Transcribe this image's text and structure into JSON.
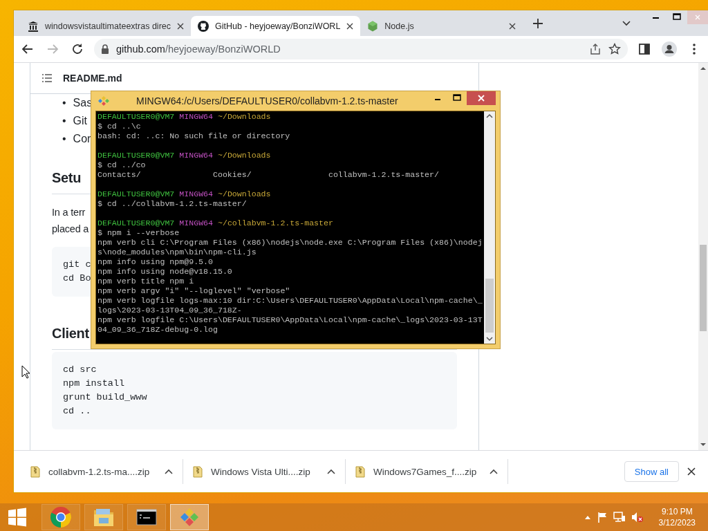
{
  "browser": {
    "tabs": [
      {
        "title": "windowsvistaultimateextras direc",
        "selected": false
      },
      {
        "title": "GitHub - heyjoeway/BonziWORL",
        "selected": true
      },
      {
        "title": "Node.js",
        "selected": false
      }
    ],
    "forward_disabled": true,
    "url": {
      "host": "github.com",
      "path": "/heyjoeway/BonziWORLD"
    }
  },
  "readme": {
    "file": "README.md",
    "blocks": [
      {
        "kind": "list",
        "marker": "•",
        "items": [
          "Sas",
          "Git",
          "Cor"
        ]
      },
      {
        "kind": "heading",
        "text": "Setu"
      },
      {
        "kind": "paragraph",
        "lines": [
          "In a terr",
          "placed a"
        ]
      },
      {
        "kind": "code",
        "lines": [
          "git c",
          "cd Bo"
        ]
      },
      {
        "kind": "heading",
        "text": "Client"
      },
      {
        "kind": "code",
        "lines": [
          "cd src",
          "npm install",
          "grunt build_www",
          "cd .."
        ]
      }
    ]
  },
  "downloads": {
    "items": [
      {
        "name": "collabvm-1.2.ts-ma....zip"
      },
      {
        "name": "Windows Vista Ulti....zip"
      },
      {
        "name": "Windows7Games_f....zip"
      }
    ],
    "button": "Show all"
  },
  "terminal": {
    "title": "MINGW64:/c/Users/DEFAULTUSER0/collabvm-1.2.ts-master",
    "lines": [
      {
        "kind": "prompt",
        "user": "DEFAULTUSER0@VM7",
        "shell": "MINGW64",
        "cwd": "~/Downloads"
      },
      {
        "kind": "text",
        "text": "$ cd ..\\c"
      },
      {
        "kind": "text",
        "text": "bash: cd: ..c: No such file or directory"
      },
      {
        "kind": "blank"
      },
      {
        "kind": "prompt",
        "user": "DEFAULTUSER0@VM7",
        "shell": "MINGW64",
        "cwd": "~/Downloads"
      },
      {
        "kind": "text",
        "text": "$ cd ../co"
      },
      {
        "kind": "text",
        "text": "Contacts/               Cookies/                collabvm-1.2.ts-master/"
      },
      {
        "kind": "blank"
      },
      {
        "kind": "prompt",
        "user": "DEFAULTUSER0@VM7",
        "shell": "MINGW64",
        "cwd": "~/Downloads"
      },
      {
        "kind": "text",
        "text": "$ cd ../collabvm-1.2.ts-master/"
      },
      {
        "kind": "blank"
      },
      {
        "kind": "prompt",
        "user": "DEFAULTUSER0@VM7",
        "shell": "MINGW64",
        "cwd": "~/collabvm-1.2.ts-master"
      },
      {
        "kind": "text",
        "text": "$ npm i --verbose"
      },
      {
        "kind": "text",
        "text": "npm verb cli C:\\Program Files (x86)\\nodejs\\node.exe C:\\Program Files (x86)\\nodej"
      },
      {
        "kind": "text",
        "text": "s\\node_modules\\npm\\bin\\npm-cli.js"
      },
      {
        "kind": "text",
        "text": "npm info using npm@9.5.0"
      },
      {
        "kind": "text",
        "text": "npm info using node@v18.15.0"
      },
      {
        "kind": "text",
        "text": "npm verb title npm i"
      },
      {
        "kind": "text",
        "text": "npm verb argv \"i\" \"--loglevel\" \"verbose\""
      },
      {
        "kind": "text",
        "text": "npm verb logfile logs-max:10 dir:C:\\Users\\DEFAULTUSER0\\AppData\\Local\\npm-cache\\_"
      },
      {
        "kind": "text",
        "text": "logs\\2023-03-13T04_09_36_718Z-"
      },
      {
        "kind": "text",
        "text": "npm verb logfile C:\\Users\\DEFAULTUSER0\\AppData\\Local\\npm-cache\\_logs\\2023-03-13T"
      },
      {
        "kind": "text",
        "text": "04_09_36_718Z-debug-0.log"
      }
    ]
  },
  "taskbar": {
    "apps": [
      {
        "selected": false
      },
      {
        "selected": false
      },
      {
        "selected": false
      },
      {
        "selected": true
      }
    ],
    "clock": {
      "time": "9:10 PM",
      "date": "3/12/2023"
    }
  }
}
